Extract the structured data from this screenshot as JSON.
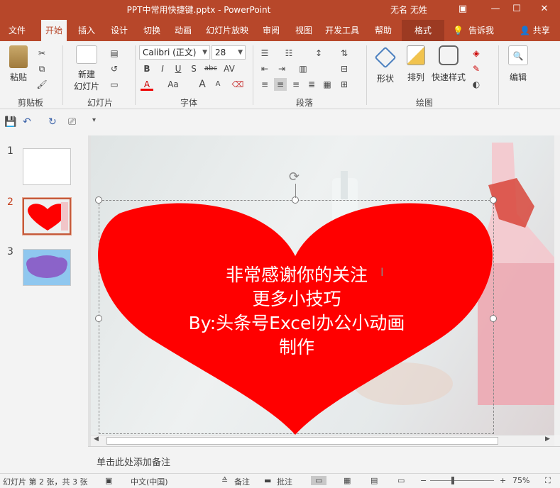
{
  "window": {
    "title": "PPT中常用快捷键.pptx  -  PowerPoint",
    "user": "无名 无姓",
    "minimize": "—",
    "restore": "☐",
    "close": "✕"
  },
  "tabs": [
    {
      "label": "文件"
    },
    {
      "label": "开始"
    },
    {
      "label": "插入"
    },
    {
      "label": "设计"
    },
    {
      "label": "切换"
    },
    {
      "label": "动画"
    },
    {
      "label": "幻灯片放映"
    },
    {
      "label": "审阅"
    },
    {
      "label": "视图"
    },
    {
      "label": "开发工具"
    },
    {
      "label": "帮助"
    },
    {
      "label": "格式"
    },
    {
      "label": "告诉我"
    },
    {
      "label": "共享"
    }
  ],
  "ribbon": {
    "clipboard": {
      "paste": "粘贴",
      "group": "剪贴板"
    },
    "slides": {
      "new_slide_line1": "新建",
      "new_slide_line2": "幻灯片",
      "group": "幻灯片"
    },
    "font": {
      "name": "Calibri (正文)",
      "size": "28",
      "group": "字体",
      "bold": "B",
      "italic": "I",
      "underline": "U",
      "shadow": "S",
      "strike": "abc",
      "spacing": "AV",
      "fontcolor": "A",
      "case": "Aa",
      "grow": "A",
      "shrink": "A"
    },
    "paragraph": {
      "group": "段落"
    },
    "drawing": {
      "shapes": "形状",
      "arrange": "排列",
      "quickstyles": "快速样式",
      "group": "绘图"
    },
    "editing": {
      "label": "编辑"
    }
  },
  "slides": [
    {
      "number": "1"
    },
    {
      "number": "2"
    },
    {
      "number": "3"
    }
  ],
  "slide": {
    "lines": [
      "非常感谢你的关注",
      "更多小技巧",
      "By:头条号Excel办公小动画",
      "制作"
    ],
    "heart_color": "#ff0000"
  },
  "notes": {
    "placeholder": "单击此处添加备注"
  },
  "status": {
    "slide_info": "幻灯片 第 2 张，共 3 张",
    "language": "中文(中国)",
    "notes": "备注",
    "comments": "批注",
    "zoom": "75%"
  },
  "colors": {
    "accent": "#b7472a"
  }
}
